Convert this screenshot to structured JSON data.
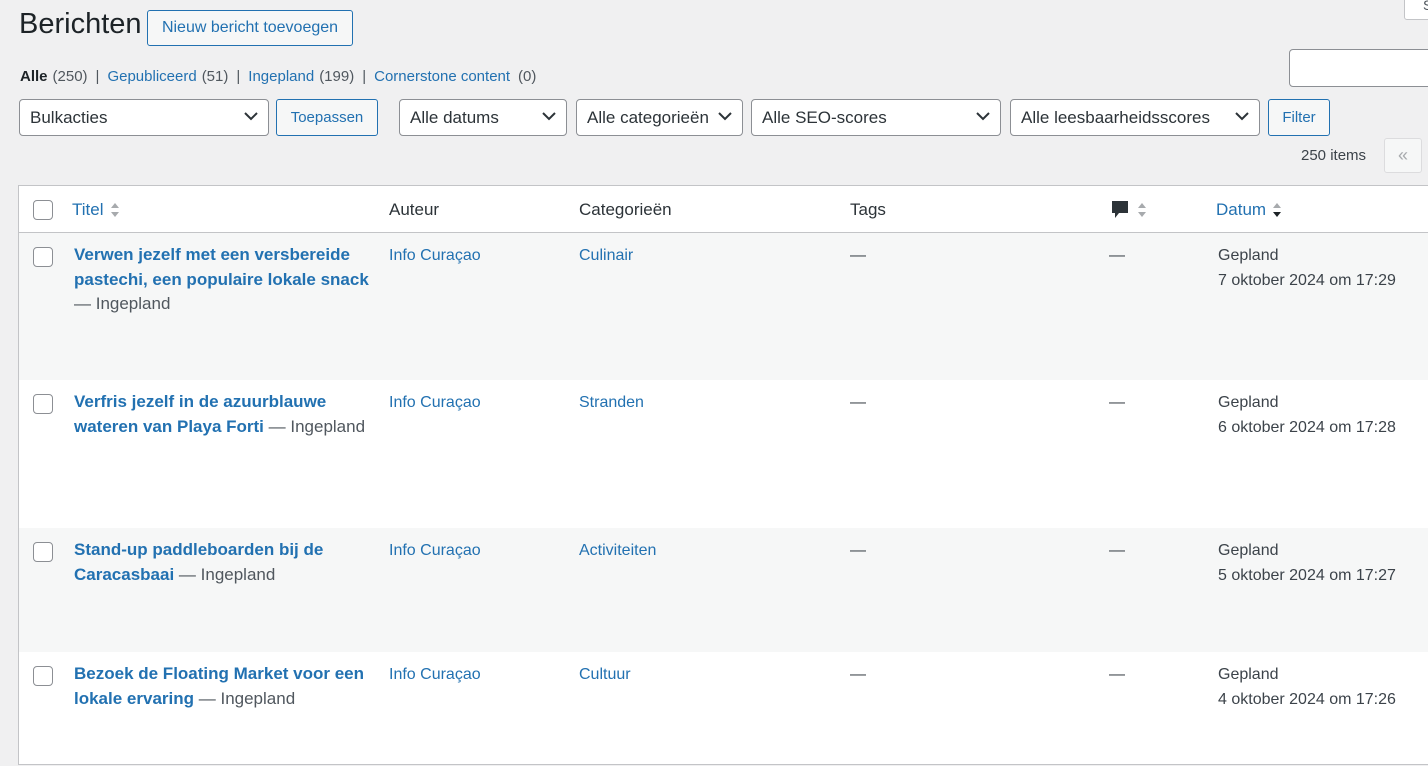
{
  "header": {
    "title": "Berichten",
    "add_new_label": "Nieuw bericht toevoegen",
    "top_right_label": "S"
  },
  "views": [
    {
      "label": "Alle",
      "count": "(250)"
    },
    {
      "label": "Gepubliceerd",
      "count": "(51)"
    },
    {
      "label": "Ingepland",
      "count": "(199)"
    },
    {
      "label": "Cornerstone content",
      "count": "(0)"
    }
  ],
  "filters": {
    "bulk_actions": "Bulkacties",
    "apply_label": "Toepassen",
    "dates": "Alle datums",
    "categories": "Alle categorieën",
    "seo_scores": "Alle SEO-scores",
    "readability": "Alle leesbaarheidsscores",
    "filter_label": "Filter"
  },
  "pagination": {
    "items_count": "250 items",
    "first_page": "«"
  },
  "table": {
    "columns": {
      "title": "Titel",
      "author": "Auteur",
      "categories": "Categorieën",
      "tags": "Tags",
      "comments_icon": "comment-bubble-icon",
      "date": "Datum"
    },
    "rows": [
      {
        "title_line1": "Verwen jezelf met een versbereide",
        "title_line2": "pastechi, een populaire lokale snack",
        "state": "— Ingepland",
        "author": "Info Curaçao",
        "category": "Culinair",
        "tags": "—",
        "comments": "—",
        "date_status": "Gepland",
        "date": "7 oktober 2024 om 17:29"
      },
      {
        "title_line1": "Verfris jezelf in de azuurblauwe",
        "title_line2": "wateren van Playa Forti",
        "state": "— Ingepland",
        "author": "Info Curaçao",
        "category": "Stranden",
        "tags": "—",
        "comments": "—",
        "date_status": "Gepland",
        "date": "6 oktober 2024 om 17:28"
      },
      {
        "title_line1": "Stand-up paddleboarden bij de",
        "title_line2": "Caracasbaai",
        "state": "— Ingepland",
        "author": "Info Curaçao",
        "category": "Activiteiten",
        "tags": "—",
        "comments": "—",
        "date_status": "Gepland",
        "date": "5 oktober 2024 om 17:27"
      },
      {
        "title_line1": "Bezoek de Floating Market voor een",
        "title_line2": "lokale ervaring",
        "state": "— Ingepland",
        "author": "Info Curaçao",
        "category": "Cultuur",
        "tags": "—",
        "comments": "—",
        "date_status": "Gepland",
        "date": "4 oktober 2024 om 17:26"
      }
    ]
  },
  "colors": {
    "link": "#2271b1",
    "background": "#f0f0f1",
    "text": "#1d2327"
  }
}
